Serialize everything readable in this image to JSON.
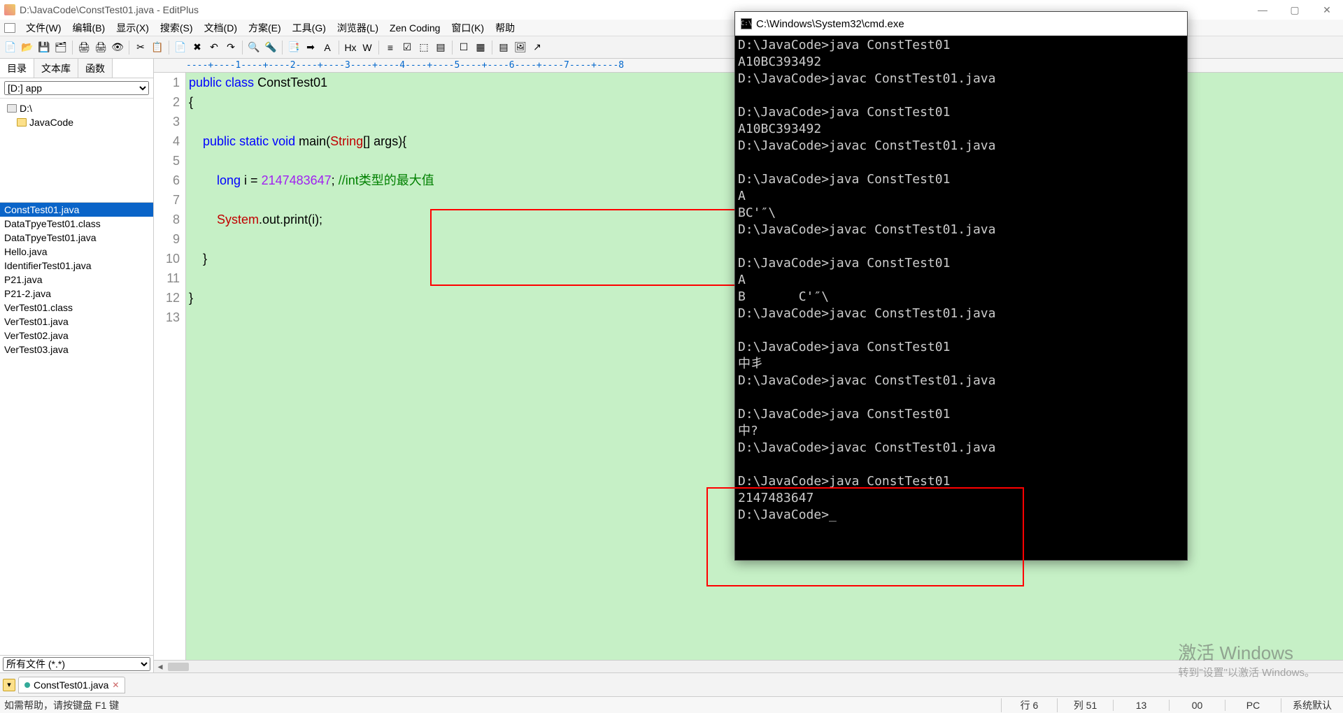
{
  "title": "D:\\JavaCode\\ConstTest01.java - EditPlus",
  "menubar": [
    "文件(W)",
    "编辑(B)",
    "显示(X)",
    "搜索(S)",
    "文档(D)",
    "方案(E)",
    "工具(G)",
    "浏览器(L)",
    "Zen Coding",
    "窗口(K)",
    "帮助"
  ],
  "toolbar_icons": [
    "📄",
    "📂",
    "💾",
    "🗂",
    "🖨",
    "🖨",
    "👁",
    "✂",
    "📋",
    "📄",
    "✖",
    "↶",
    "↷",
    "🔍",
    "🔦",
    "📑",
    "➡",
    "A",
    "Hx",
    "W",
    "≡",
    "☑",
    "⬚",
    "▤",
    "☐",
    "▦",
    "▤",
    "🖼",
    "↗"
  ],
  "sidebar": {
    "tabs": [
      "目录",
      "文本库",
      "函数"
    ],
    "combo": "[D:] app",
    "tree": {
      "root": "D:\\",
      "child": "JavaCode"
    },
    "files": [
      "ConstTest01.java",
      "DataTpyeTest01.class",
      "DataTpyeTest01.java",
      "Hello.java",
      "IdentifierTest01.java",
      "P21.java",
      "P21-2.java",
      "VerTest01.class",
      "VerTest01.java",
      "VerTest02.java",
      "VerTest03.java"
    ],
    "filter": "所有文件 (*.*)"
  },
  "ruler": "----+----1----+----2----+----3----+----4----+----5----+----6----+----7----+----8",
  "code": {
    "lines": [
      {
        "n": 1,
        "html": "<span class='kw1'>public</span> <span class='kw1'>class</span> ConstTest01"
      },
      {
        "n": 2,
        "html": "{",
        "fold": "⊟"
      },
      {
        "n": 3,
        "html": ""
      },
      {
        "n": 4,
        "html": "    <span class='kw1'>public</span> <span class='kw1'>static</span> <span class='kw1'>void</span> main(<span class='type'>String</span>[] args){",
        "fold": "⊟"
      },
      {
        "n": 5,
        "html": ""
      },
      {
        "n": 6,
        "html": "        <span class='kw2'>long</span> i = <span class='num'>2147483647</span>; <span class='cmt'>//int类型的最大值</span>"
      },
      {
        "n": 7,
        "html": ""
      },
      {
        "n": 8,
        "html": "        <span class='type'>System</span>.out.print(i);"
      },
      {
        "n": 9,
        "html": ""
      },
      {
        "n": 10,
        "html": "    }"
      },
      {
        "n": 11,
        "html": "    "
      },
      {
        "n": 12,
        "html": "}"
      },
      {
        "n": 13,
        "html": ""
      }
    ]
  },
  "doctab": "ConstTest01.java",
  "statusbar": {
    "help": "如需帮助，请按键盘 F1 键",
    "line": "行 6",
    "col": "列 51",
    "v1": "13",
    "v2": "00",
    "mode": "PC",
    "enc": "系统默认"
  },
  "cmd": {
    "title": "C:\\Windows\\System32\\cmd.exe",
    "body": "D:\\JavaCode>java ConstTest01\nA10BC393492\nD:\\JavaCode>javac ConstTest01.java\n\nD:\\JavaCode>java ConstTest01\nA10BC393492\nD:\\JavaCode>javac ConstTest01.java\n\nD:\\JavaCode>java ConstTest01\nA\nBC'″\\\nD:\\JavaCode>javac ConstTest01.java\n\nD:\\JavaCode>java ConstTest01\nA\nB       C'″\\\nD:\\JavaCode>javac ConstTest01.java\n\nD:\\JavaCode>java ConstTest01\n中丯\nD:\\JavaCode>javac ConstTest01.java\n\nD:\\JavaCode>java ConstTest01\n中?\nD:\\JavaCode>javac ConstTest01.java\n\nD:\\JavaCode>java ConstTest01\n2147483647\nD:\\JavaCode>_"
  },
  "watermark": {
    "l1": "激活 Windows",
    "l2": "转到\"设置\"以激活 Windows。"
  }
}
